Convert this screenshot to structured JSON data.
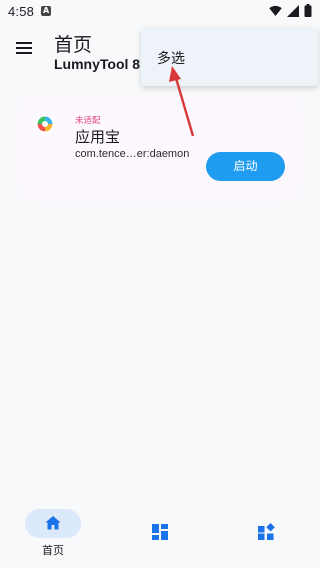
{
  "status_bar": {
    "time": "4:58",
    "notification_letter": "A"
  },
  "app_bar": {
    "title": "首页",
    "subtitle": "LumnyTool 8"
  },
  "popup_menu": {
    "items": [
      {
        "label": "多选"
      }
    ]
  },
  "app_card": {
    "badge": "未适配",
    "name": "应用宝",
    "package": "com.tence…er:daemon",
    "launch_label": "启动"
  },
  "bottom_nav": {
    "items": [
      {
        "label": "首页",
        "icon": "home-icon",
        "active": true
      },
      {
        "label": "",
        "icon": "dashboard-icon",
        "active": false
      },
      {
        "label": "",
        "icon": "widgets-icon",
        "active": false
      }
    ]
  },
  "colors": {
    "accent": "#1f9bf0",
    "nav_icon": "#1a73e8",
    "badge": "#e2487b",
    "annotation_arrow": "#d93838"
  }
}
